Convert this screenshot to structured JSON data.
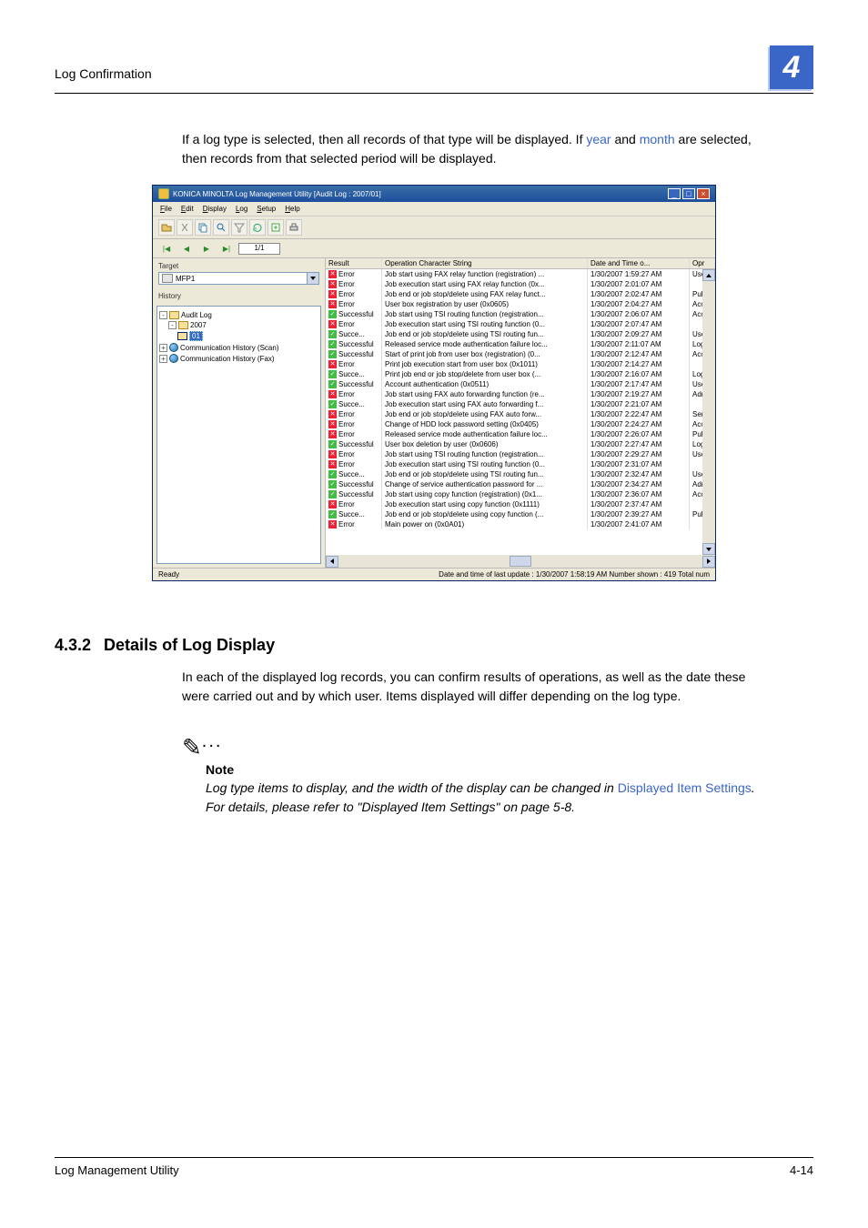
{
  "header": {
    "title": "Log Confirmation",
    "chapter_number": "4"
  },
  "intro": {
    "part1": "If a log type is selected, then all records of that type will be displayed. If ",
    "link1": "year",
    "mid": " and ",
    "link2": "month",
    "part2": " are selected, then records from that selected period will be displayed."
  },
  "screenshot": {
    "window_title": "KONICA MINOLTA Log Management Utility [Audit Log : 2007/01]",
    "menus": [
      "File",
      "Edit",
      "Display",
      "Log",
      "Setup",
      "Help"
    ],
    "pager": "1/1",
    "target_label": "Target",
    "history_label": "History",
    "device": "MFP1",
    "tree": {
      "root": "Audit Log",
      "year": "2007",
      "month": "01",
      "scan": "Communication History (Scan)",
      "fax": "Communication History (Fax)"
    },
    "columns": {
      "result": "Result",
      "op": "Operation Character String",
      "dt": "Date and Time o...",
      "opr": "Opr"
    },
    "rows": [
      {
        "r": "Error",
        "o": "Job start using FAX relay function (registration) ...",
        "d": "1/30/2007 1:59:27 AM",
        "p": "Use"
      },
      {
        "r": "Error",
        "o": "Job execution start using FAX relay function (0x...",
        "d": "1/30/2007 2:01:07 AM",
        "p": ""
      },
      {
        "r": "Error",
        "o": "Job end or job stop/delete using FAX relay funct...",
        "d": "1/30/2007 2:02:47 AM",
        "p": "Pub"
      },
      {
        "r": "Error",
        "o": "User box registration by user (0x0605)",
        "d": "1/30/2007 2:04:27 AM",
        "p": "Acc"
      },
      {
        "r": "Successful",
        "o": "Job start using TSI routing function (registration...",
        "d": "1/30/2007 2:06:07 AM",
        "p": "Acc"
      },
      {
        "r": "Error",
        "o": "Job execution start using TSI routing function (0...",
        "d": "1/30/2007 2:07:47 AM",
        "p": ""
      },
      {
        "r": "Succe...",
        "o": "Job end or job stop/delete using TSI routing fun...",
        "d": "1/30/2007 2:09:27 AM",
        "p": "Use"
      },
      {
        "r": "Successful",
        "o": "Released service mode authentication failure loc...",
        "d": "1/30/2007 2:11:07 AM",
        "p": "Log"
      },
      {
        "r": "Successful",
        "o": "Start of print job from user box (registration) (0...",
        "d": "1/30/2007 2:12:47 AM",
        "p": "Acc"
      },
      {
        "r": "Error",
        "o": "Print job execution start from user box (0x1011)",
        "d": "1/30/2007 2:14:27 AM",
        "p": ""
      },
      {
        "r": "Succe...",
        "o": "Print job end or job stop/delete from user box (...",
        "d": "1/30/2007 2:16:07 AM",
        "p": "Log"
      },
      {
        "r": "Successful",
        "o": "Account authentication (0x0511)",
        "d": "1/30/2007 2:17:47 AM",
        "p": "Use"
      },
      {
        "r": "Error",
        "o": "Job start using FAX auto forwarding function (re...",
        "d": "1/30/2007 2:19:27 AM",
        "p": "Adr"
      },
      {
        "r": "Succe...",
        "o": "Job execution start using FAX auto forwarding f...",
        "d": "1/30/2007 2:21:07 AM",
        "p": ""
      },
      {
        "r": "Error",
        "o": "Job end or job stop/delete using FAX auto forw...",
        "d": "1/30/2007 2:22:47 AM",
        "p": "Ser"
      },
      {
        "r": "Error",
        "o": "Change of HDD lock password setting (0x0405)",
        "d": "1/30/2007 2:24:27 AM",
        "p": "Acc"
      },
      {
        "r": "Error",
        "o": "Released service mode authentication failure loc...",
        "d": "1/30/2007 2:26:07 AM",
        "p": "Pub"
      },
      {
        "r": "Successful",
        "o": "User box deletion by user (0x0606)",
        "d": "1/30/2007 2:27:47 AM",
        "p": "Log"
      },
      {
        "r": "Error",
        "o": "Job start using TSI routing function (registration...",
        "d": "1/30/2007 2:29:27 AM",
        "p": "Use"
      },
      {
        "r": "Error",
        "o": "Job execution start using TSI routing function (0...",
        "d": "1/30/2007 2:31:07 AM",
        "p": ""
      },
      {
        "r": "Succe...",
        "o": "Job end or job stop/delete using TSI routing fun...",
        "d": "1/30/2007 2:32:47 AM",
        "p": "Use"
      },
      {
        "r": "Successful",
        "o": "Change of service authentication password for ...",
        "d": "1/30/2007 2:34:27 AM",
        "p": "Adr"
      },
      {
        "r": "Successful",
        "o": "Job start using copy function (registration) (0x1...",
        "d": "1/30/2007 2:36:07 AM",
        "p": "Acc"
      },
      {
        "r": "Error",
        "o": "Job execution start using copy function (0x1111)",
        "d": "1/30/2007 2:37:47 AM",
        "p": ""
      },
      {
        "r": "Succe...",
        "o": "Job end or job stop/delete using copy function (...",
        "d": "1/30/2007 2:39:27 AM",
        "p": "Pub"
      },
      {
        "r": "Error",
        "o": "Main power on (0x0A01)",
        "d": "1/30/2007 2:41:07 AM",
        "p": ""
      }
    ],
    "status_left": "Ready",
    "status_right": "Date and time of last update : 1/30/2007 1:58:19 AM   Number shown : 419   Total num"
  },
  "section": {
    "number": "4.3.2",
    "title": "Details of Log Display",
    "body": "In each of the displayed log records, you can confirm results of operations, as well as the date these were carried out and by which user. Items displayed will differ depending on the log type."
  },
  "note": {
    "label": "Note",
    "pre": "Log type items to display, and the width of the display can be changed in ",
    "link": "Displayed Item Settings",
    "post": ". For details, please refer to \"Displayed Item Settings\" on page 5-8."
  },
  "footer": {
    "left": "Log Management Utility",
    "right": "4-14"
  }
}
